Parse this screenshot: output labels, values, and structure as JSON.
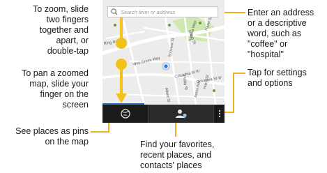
{
  "search": {
    "placeholder": "Search term or address"
  },
  "map": {
    "streets": [
      "Wes Green Way",
      "Hatch St",
      "Columbia St W",
      "Columbia St W",
      "Phillip St",
      "Hazel St",
      "Albert St",
      "Sunview St",
      "Ring Rd",
      "Tonkwa Way",
      "Hazel St",
      "Amos Ave"
    ]
  },
  "annotations": {
    "zoom": "To zoom, slide\ntwo fingers\ntogether and\napart, or\ndouble-tap",
    "pan": "To pan a zoomed\nmap, slide your\nfinger on the\nscreen",
    "pins": "See places as pins\non the map",
    "search": "Enter an address\nor a descriptive\nword, such as\n\"coffee\" or\n\"hospital\"",
    "settings": "Tap for settings\nand options",
    "favorites": "Find your favorites,\nrecent places, and\ncontacts' places"
  },
  "colors": {
    "callout_line": "#f2b01e",
    "gesture_arrow": "#f2c21b",
    "location_dot": "#2d7ad6",
    "toolbar": "#1a1a1a",
    "map_background": "#ececea",
    "road": "#ffffff",
    "park": "#cfe7b0"
  },
  "icons": [
    "search-icon",
    "globe-pins-icon",
    "contact-place-icon",
    "more-options-icon",
    "location-pin-icon"
  ]
}
